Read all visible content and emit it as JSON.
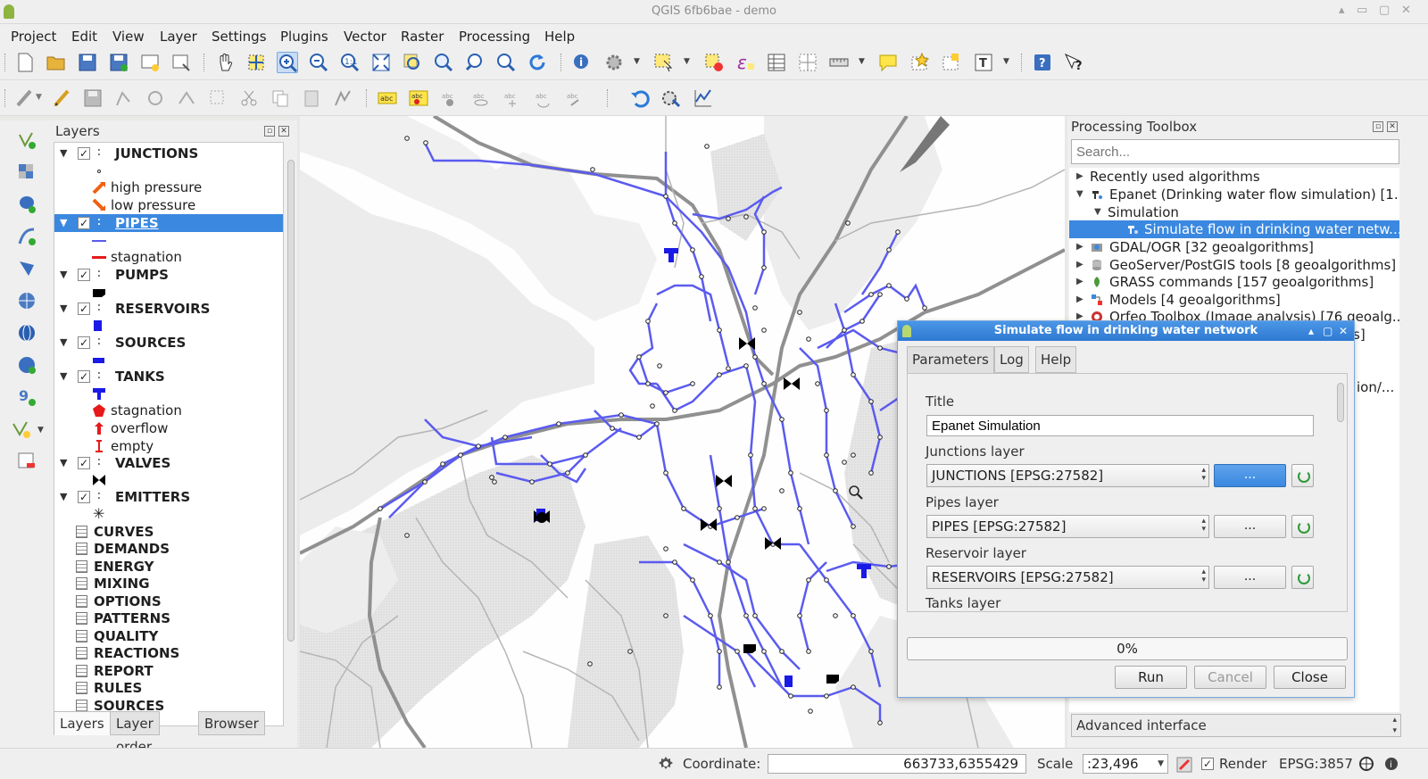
{
  "window": {
    "title": "QGIS 6fb6bae - demo"
  },
  "menu": [
    "Project",
    "Edit",
    "View",
    "Layer",
    "Settings",
    "Plugins",
    "Vector",
    "Raster",
    "Processing",
    "Help"
  ],
  "layers_panel": {
    "title": "Layers",
    "groups": [
      {
        "name": "JUNCTIONS",
        "items": [
          "high pressure",
          "low pressure"
        ]
      },
      {
        "name": "PIPES",
        "items": [
          "stagnation"
        ]
      },
      {
        "name": "PUMPS",
        "items": []
      },
      {
        "name": "RESERVOIRS",
        "items": []
      },
      {
        "name": "SOURCES",
        "items": []
      },
      {
        "name": "TANKS",
        "items": [
          "stagnation",
          "overflow",
          "empty"
        ]
      },
      {
        "name": "VALVES",
        "items": []
      },
      {
        "name": "EMITTERS",
        "items": []
      }
    ],
    "tables": [
      "CURVES",
      "DEMANDS",
      "ENERGY",
      "MIXING",
      "OPTIONS",
      "PATTERNS",
      "QUALITY",
      "REACTIONS",
      "REPORT",
      "RULES",
      "SOURCES"
    ],
    "tabs": [
      "Layers",
      "Layer order",
      "Browser"
    ]
  },
  "toolbox": {
    "title": "Processing Toolbox",
    "search_placeholder": "Search...",
    "items": [
      "Recently used algorithms",
      "Epanet (Drinking water flow simulation) [1...",
      "Simulation",
      "Simulate flow in drinking water netw...",
      "GDAL/OGR [32 geoalgorithms]",
      "GeoServer/PostGIS tools [8 geoalgorithms]",
      "GRASS commands [157 geoalgorithms]",
      "Models [4 geoalgorithms]",
      "Orfeo Toolbox (Image analysis) [76 geoalg..."
    ],
    "hidden_fragments": [
      "s]",
      "ion/..."
    ],
    "interface_select": "Advanced interface"
  },
  "dialog": {
    "title": "Simulate flow in drinking water network",
    "tabs": [
      "Parameters",
      "Log",
      "Help"
    ],
    "title_label": "Title",
    "title_value": "Epanet Simulation",
    "junctions_label": "Junctions layer",
    "junctions_value": "JUNCTIONS [EPSG:27582]",
    "pipes_label": "Pipes layer",
    "pipes_value": "PIPES [EPSG:27582]",
    "reservoir_label": "Reservoir layer",
    "reservoir_value": "RESERVOIRS [EPSG:27582]",
    "tanks_label": "Tanks layer",
    "browse_label": "...",
    "progress_text": "0%",
    "progress_value": 0,
    "run_label": "Run",
    "cancel_label": "Cancel",
    "close_label": "Close"
  },
  "status": {
    "coordinate_label": "Coordinate:",
    "coordinate_value": "663733,6355429",
    "scale_label": "Scale",
    "scale_value": ":23,496",
    "render_label": "Render",
    "crs": "EPSG:3857"
  },
  "colors": {
    "accent": "#3a88e0",
    "pipe": "#5b5bf0",
    "road": "#909090"
  }
}
